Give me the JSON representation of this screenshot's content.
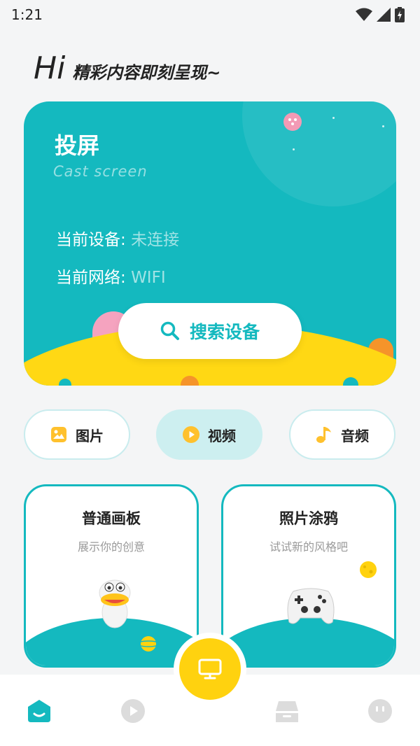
{
  "status_bar": {
    "time": "1:21"
  },
  "greeting": {
    "hi": "Hi",
    "subtitle": "精彩内容即刻呈现~"
  },
  "cast_card": {
    "title": "投屏",
    "subtitle": "Cast screen",
    "device_label": "当前设备:",
    "device_value": "未连接",
    "network_label": "当前网络:",
    "network_value": "WIFI",
    "search_button": "搜索设备"
  },
  "media_tabs": [
    {
      "label": "图片",
      "icon": "image-icon",
      "active": false
    },
    {
      "label": "视频",
      "icon": "play-icon",
      "active": true
    },
    {
      "label": "音频",
      "icon": "music-note-icon",
      "active": false
    }
  ],
  "features": [
    {
      "title": "普通画板",
      "desc": "展示你的创意",
      "illustration": "duck-character-icon"
    },
    {
      "title": "照片涂鸦",
      "desc": "试试新的风格吧",
      "illustration": "gamepad-icon"
    }
  ],
  "bottom_nav": [
    {
      "name": "home-icon",
      "active": true
    },
    {
      "name": "video-icon",
      "active": false
    },
    {
      "name": "cast-icon",
      "active": true,
      "center": true
    },
    {
      "name": "box-icon",
      "active": false
    },
    {
      "name": "profile-icon",
      "active": false
    }
  ],
  "colors": {
    "accent": "#14b9bf",
    "yellow": "#ffd20f",
    "tab_active_bg": "#cdeff0",
    "inactive_icon": "#d8d8d8"
  }
}
